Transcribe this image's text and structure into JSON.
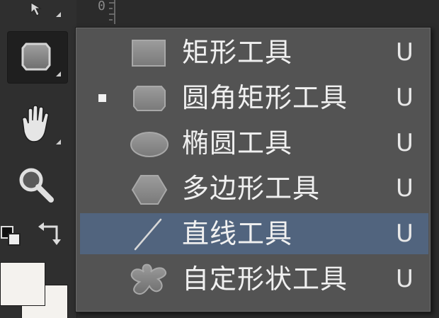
{
  "menu": {
    "items": [
      {
        "label": "矩形工具",
        "shortcut": "U",
        "icon": "rectangle-icon",
        "selected": false,
        "highlighted": false
      },
      {
        "label": "圆角矩形工具",
        "shortcut": "U",
        "icon": "rounded-rectangle-icon",
        "selected": true,
        "highlighted": false
      },
      {
        "label": "椭圆工具",
        "shortcut": "U",
        "icon": "ellipse-icon",
        "selected": false,
        "highlighted": false
      },
      {
        "label": "多边形工具",
        "shortcut": "U",
        "icon": "polygon-icon",
        "selected": false,
        "highlighted": false
      },
      {
        "label": "直线工具",
        "shortcut": "U",
        "icon": "line-icon",
        "selected": false,
        "highlighted": true
      },
      {
        "label": "自定形状工具",
        "shortcut": "U",
        "icon": "custom-shape-icon",
        "selected": false,
        "highlighted": false
      }
    ]
  },
  "ruler": {
    "mark": "0"
  },
  "toolbar": {
    "tools": [
      "move-tool-icon",
      "rounded-rectangle-tool-icon",
      "hand-tool-icon",
      "zoom-tool-icon",
      "default-colors-icon",
      "swap-colors-icon"
    ]
  },
  "colors": {
    "menu_bg": "#535353",
    "highlight": "#51647e",
    "toolbar_bg": "#2f2f2f",
    "foreground_swatch": "#f4f2ee",
    "background_swatch": "#f4f2ee"
  }
}
